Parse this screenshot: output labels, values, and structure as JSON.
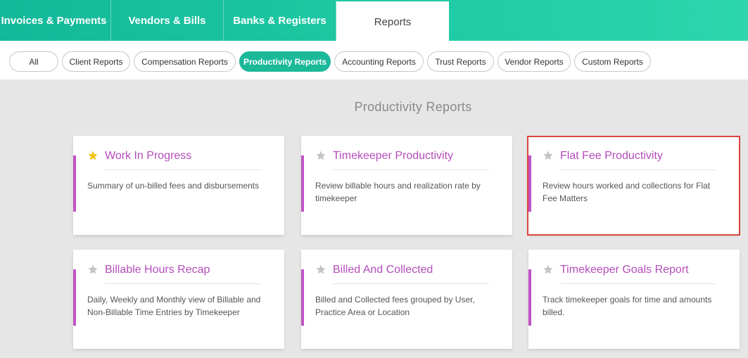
{
  "top_tabs": [
    {
      "label": "Invoices & Payments"
    },
    {
      "label": "Vendors & Bills"
    },
    {
      "label": "Banks & Registers"
    },
    {
      "label": "Reports"
    }
  ],
  "filters": [
    {
      "label": "All"
    },
    {
      "label": "Client Reports"
    },
    {
      "label": "Compensation Reports"
    },
    {
      "label": "Productivity Reports"
    },
    {
      "label": "Accounting Reports"
    },
    {
      "label": "Trust Reports"
    },
    {
      "label": "Vendor Reports"
    },
    {
      "label": "Custom Reports"
    }
  ],
  "active_filter": "Productivity Reports",
  "section": {
    "title": "Productivity Reports"
  },
  "cards": [
    {
      "title": "Work In Progress",
      "description": "Summary of un-billed fees and disbursements",
      "favorite": true
    },
    {
      "title": "Timekeeper Productivity",
      "description": "Review billable hours and realization rate by timekeeper",
      "favorite": false
    },
    {
      "title": "Flat Fee Productivity",
      "description": "Review hours worked and collections for Flat Fee Matters",
      "favorite": false
    },
    {
      "title": "Billable Hours Recap",
      "description": "Daily, Weekly and Monthly view of Billable and Non-Billable Time Entries by Timekeeper",
      "favorite": false
    },
    {
      "title": "Billed And Collected",
      "description": "Billed and Collected fees grouped by User, Practice Area or Location",
      "favorite": false
    },
    {
      "title": "Timekeeper Goals Report",
      "description": "Track timekeeper goals for time and amounts billed.",
      "favorite": false
    }
  ],
  "colors": {
    "brand": "#1bb99a",
    "accent": "#c153c6",
    "title": "#b44dbb",
    "star_active": "#f5c518",
    "star_inactive": "#c4c4c4",
    "highlight": "#d9443e"
  }
}
